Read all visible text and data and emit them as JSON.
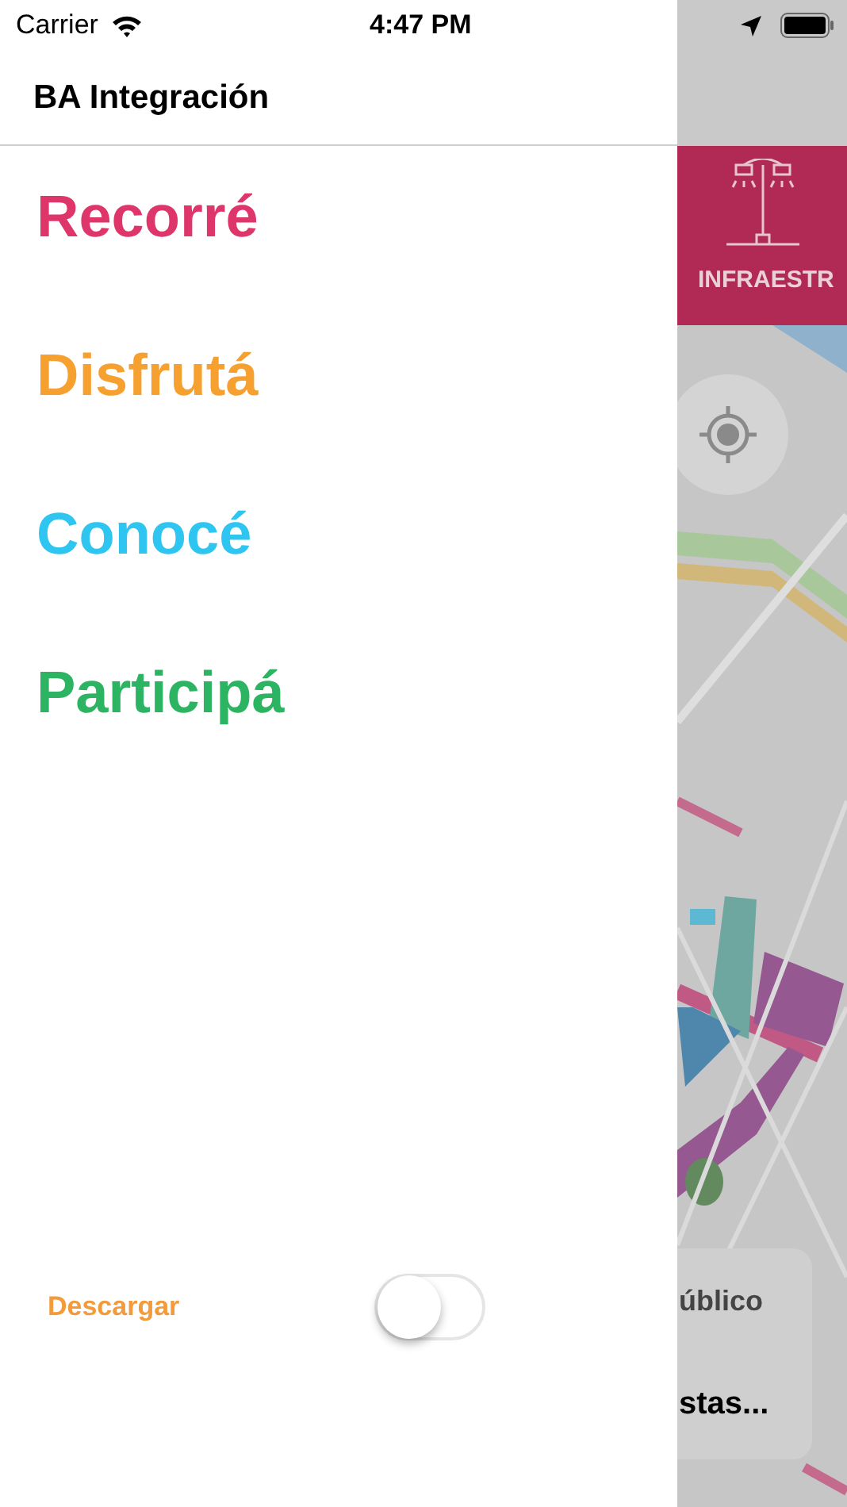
{
  "status_bar": {
    "carrier": "Carrier",
    "time": "4:47 PM"
  },
  "drawer": {
    "title": "BA Integración",
    "menu": [
      {
        "label": "Recorré",
        "color": "#de356b"
      },
      {
        "label": "Disfrutá",
        "color": "#f6a030"
      },
      {
        "label": "Conocé",
        "color": "#2ec5f0"
      },
      {
        "label": "Participá",
        "color": "#2db462"
      }
    ],
    "download": {
      "label": "Descargar",
      "on": false
    }
  },
  "background": {
    "banner": {
      "label": "INFRAESTR"
    },
    "card": {
      "line_1": "úblico",
      "line_2": "stas..."
    }
  }
}
